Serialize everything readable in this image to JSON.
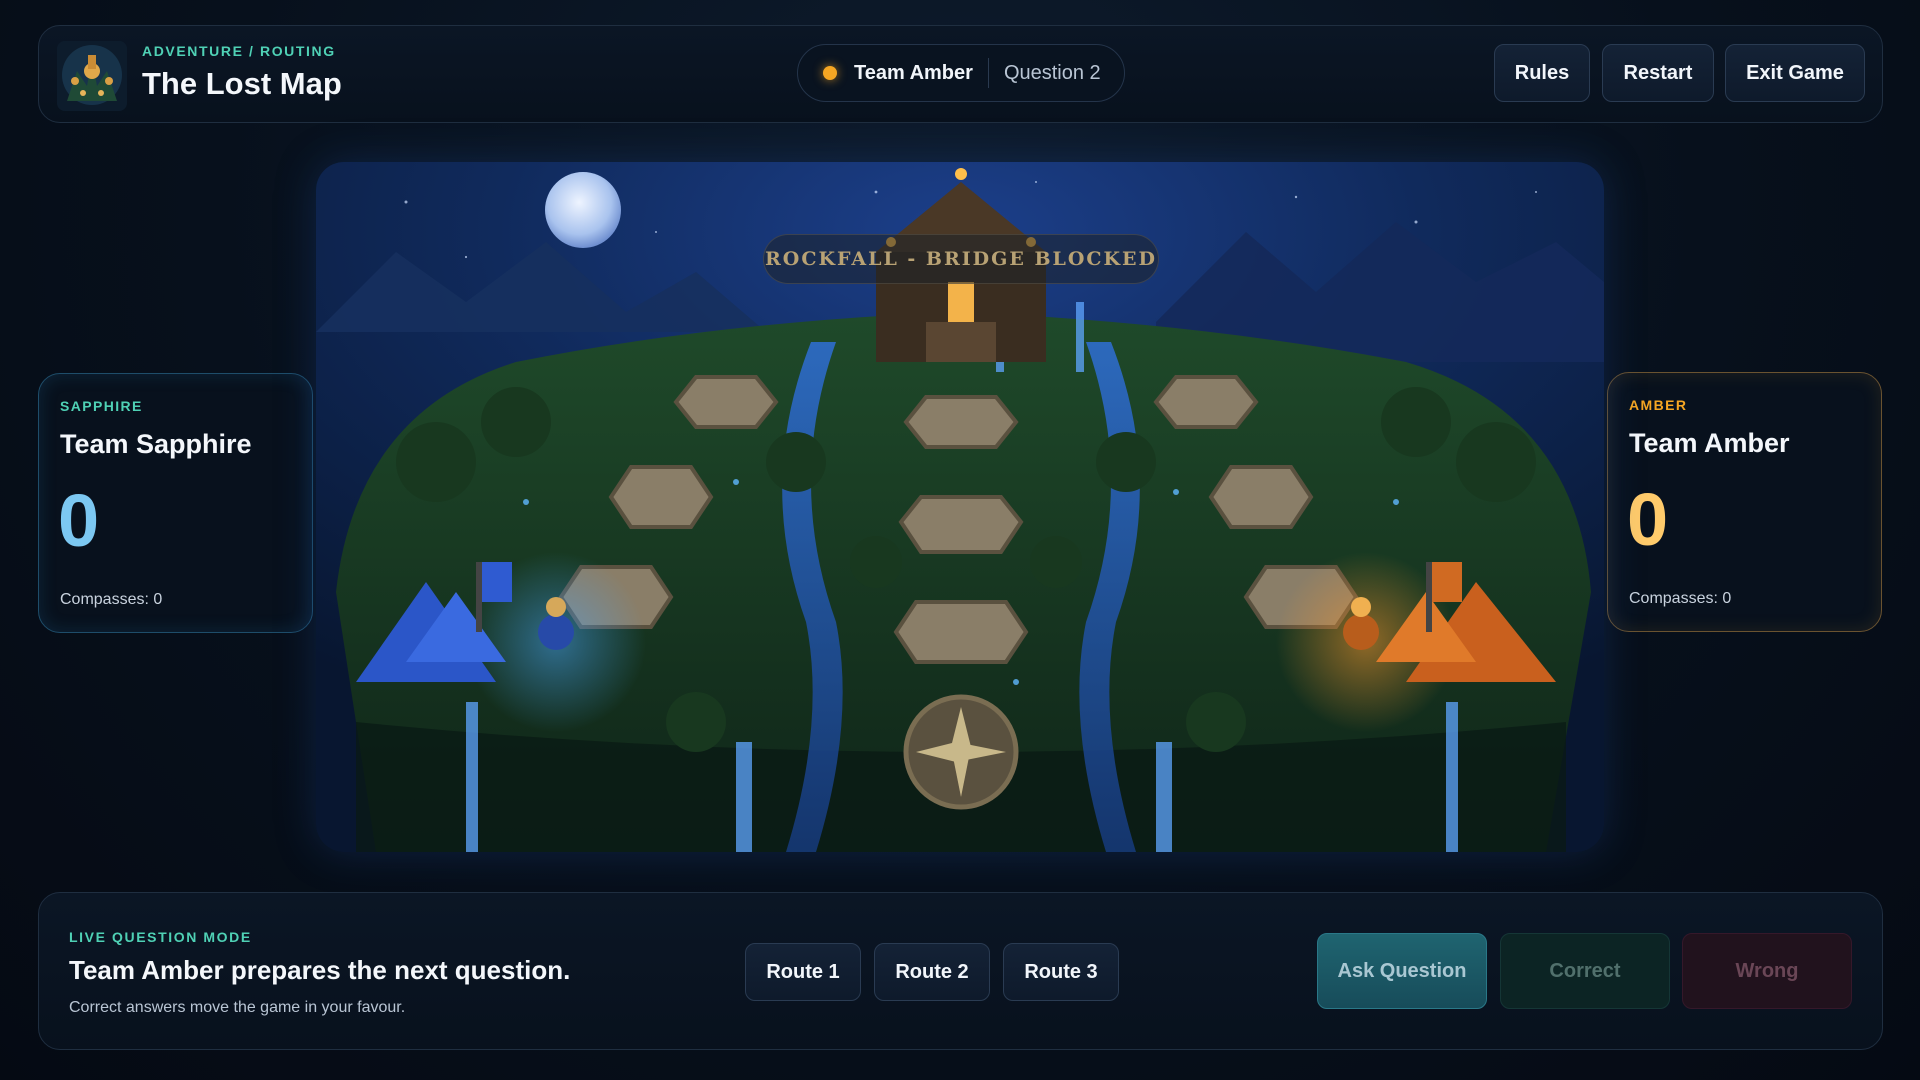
{
  "header": {
    "eyebrow": "ADVENTURE / ROUTING",
    "title": "The Lost Map",
    "turn": {
      "team": "Team Amber",
      "question": "Question 2",
      "dot_color": "#f5a623"
    },
    "buttons": {
      "rules": "Rules",
      "restart": "Restart",
      "exit": "Exit Game"
    }
  },
  "teams": {
    "sapphire": {
      "tag": "SAPPHIRE",
      "name": "Team Sapphire",
      "score": "0",
      "compasses": "Compasses: 0",
      "color": "#7cc8f2"
    },
    "amber": {
      "tag": "AMBER",
      "name": "Team Amber",
      "score": "0",
      "compasses": "Compasses: 0",
      "color": "#ffcb6b"
    }
  },
  "map": {
    "banner": "ROCKFALL - BRIDGE BLOCKED"
  },
  "bottom": {
    "mode": "LIVE QUESTION MODE",
    "prompt": "Team Amber prepares the next question.",
    "hint": "Correct answers move the game in your favour.",
    "routes": [
      "Route 1",
      "Route 2",
      "Route 3"
    ],
    "actions": {
      "ask": "Ask Question",
      "correct": "Correct",
      "wrong": "Wrong"
    }
  }
}
